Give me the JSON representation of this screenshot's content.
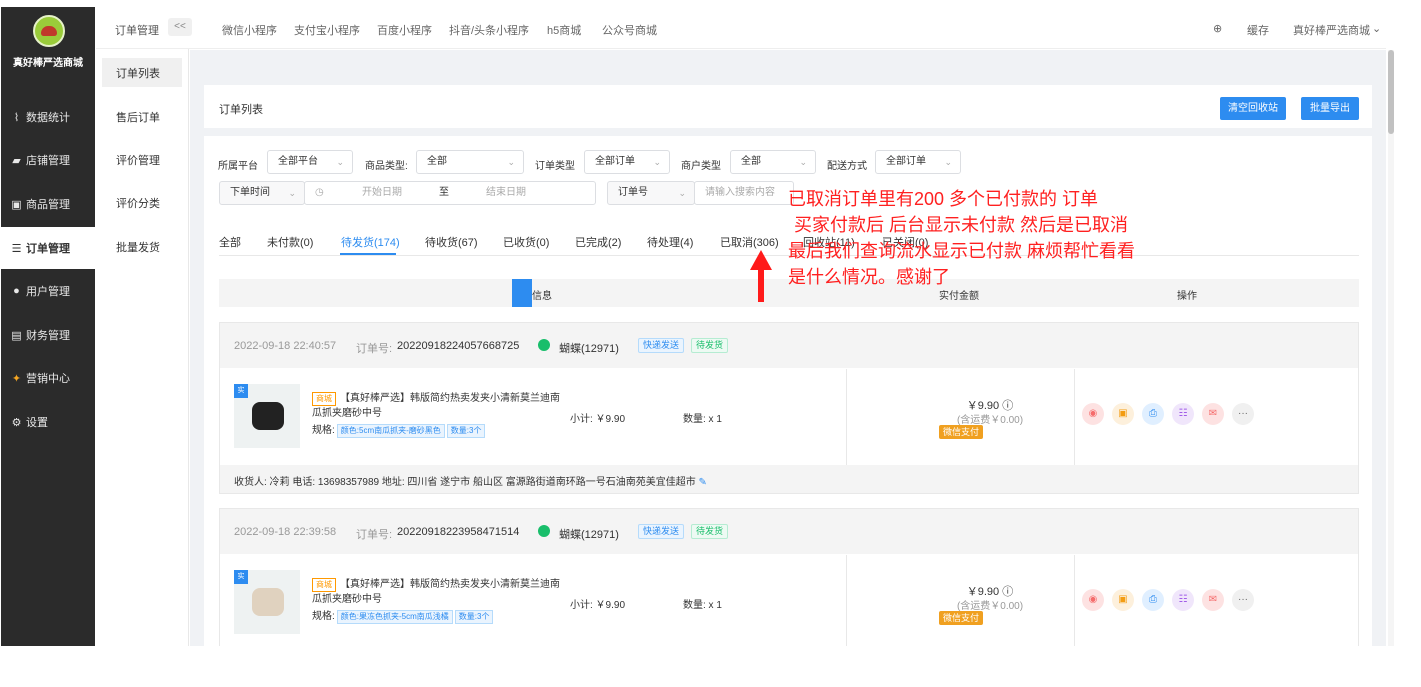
{
  "sidebar": {
    "shop_name": "真好棒严选商城",
    "items": [
      {
        "label": "数据统计",
        "icon": "chart-icon"
      },
      {
        "label": "店铺管理",
        "icon": "store-icon"
      },
      {
        "label": "商品管理",
        "icon": "goods-icon"
      },
      {
        "label": "订单管理",
        "icon": "order-icon"
      },
      {
        "label": "用户管理",
        "icon": "user-icon"
      },
      {
        "label": "财务管理",
        "icon": "finance-icon"
      },
      {
        "label": "营销中心",
        "icon": "marketing-icon"
      },
      {
        "label": "设置",
        "icon": "settings-icon"
      }
    ]
  },
  "submenu": {
    "items": [
      "订单列表",
      "售后订单",
      "评价管理",
      "评价分类",
      "批量发货"
    ]
  },
  "topnav": {
    "breadcrumb": "订单管理",
    "collapse": "<<",
    "tabs": [
      "微信小程序",
      "支付宝小程序",
      "百度小程序",
      "抖音/头条小程序",
      "h5商城",
      "公众号商城"
    ],
    "cache": "缓存",
    "shop": "真好棒严选商城"
  },
  "title_panel": {
    "title": "订单列表",
    "clear_btn": "清空回收站",
    "export_btn": "批量导出"
  },
  "filters": {
    "platform_label": "所属平台",
    "platform_value": "全部平台",
    "goods_type_label": "商品类型:",
    "goods_type_value": "全部",
    "order_type_label": "订单类型",
    "order_type_value": "全部订单",
    "merchant_type_label": "商户类型",
    "merchant_type_value": "全部",
    "delivery_label": "配送方式",
    "delivery_value": "全部订单",
    "time_select": "下单时间",
    "start_date": "开始日期",
    "to": "至",
    "end_date": "结束日期",
    "search_field": "订单号",
    "search_placeholder": "请输入搜索内容"
  },
  "tabs": [
    "全部",
    "未付款(0)",
    "待发货(174)",
    "待收货(67)",
    "已收货(0)",
    "已完成(2)",
    "待处理(4)",
    "已取消(306)",
    "回收站(11)",
    "已关闭(0)"
  ],
  "table_head": {
    "info": "订单信息",
    "amount": "实付金额",
    "ops": "操作"
  },
  "orders": [
    {
      "time": "2022-09-18 22:40:57",
      "order_label": "订单号:",
      "order_no": "20220918224057668725",
      "buyer": "蝴蝶(12971)",
      "tag1": "快递发送",
      "tag2": "待发货",
      "mall_tag": "商城",
      "title_l1": "【真好棒严选】韩版简约热卖发夹小清新莫兰迪南",
      "title_l2": "瓜抓夹磨砂中号",
      "spec_label": "规格:",
      "spec": "颜色:5cm南瓜抓夹-磨砂黑色",
      "qty_tag": "数量:3个",
      "subtotal": "小计: ￥9.90",
      "qty": "数量: x 1",
      "price": "￥9.90",
      "freight": "(含运费￥0.00)",
      "pay": "微信支付",
      "address": "收货人: 冷莉 电话: 13698357989 地址: 四川省 遂宁市 船山区 富源路街道南环路一号石油南苑美宜佳超市"
    },
    {
      "time": "2022-09-18 22:39:58",
      "order_label": "订单号:",
      "order_no": "20220918223958471514",
      "buyer": "蝴蝶(12971)",
      "tag1": "快递发送",
      "tag2": "待发货",
      "mall_tag": "商城",
      "title_l1": "【真好棒严选】韩版简约热卖发夹小清新莫兰迪南",
      "title_l2": "瓜抓夹磨砂中号",
      "spec_label": "规格:",
      "spec": "颜色:果冻色抓夹-5cm南瓜浅橘",
      "qty_tag": "数量:3个",
      "subtotal": "小计: ￥9.90",
      "qty": "数量: x 1",
      "price": "￥9.90",
      "freight": "(含运费￥0.00)",
      "pay": "微信支付"
    }
  ],
  "annotation": {
    "l1": "已取消订单里有200 多个已付款的 订单",
    "l2": "买家付款后 后台显示未付款 然后是已取消",
    "l3": "最后我们查询流水显示已付款  麻烦帮忙看看",
    "l4": "是什么情况。感谢了"
  },
  "colors": {
    "primary": "#2d8cf0",
    "sidebar": "#2b2b2b",
    "annotation": "#ff2020"
  }
}
